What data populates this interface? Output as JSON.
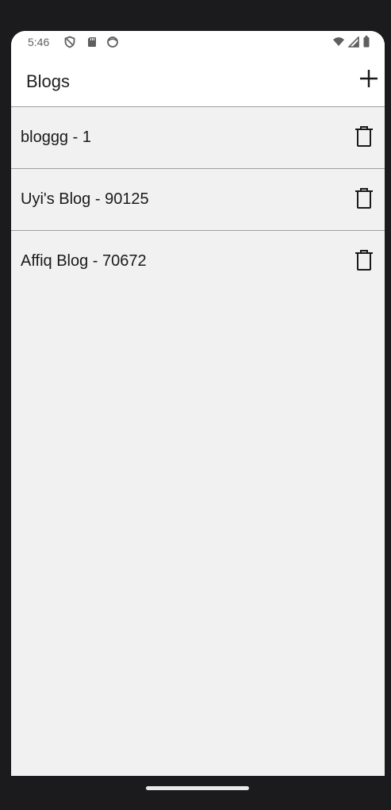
{
  "status_bar": {
    "time": "5:46",
    "left_icons": [
      "shield-icon",
      "sd-card-icon",
      "face-icon"
    ],
    "right_icons": [
      "wifi-icon",
      "signal-icon",
      "battery-icon"
    ]
  },
  "app_bar": {
    "title": "Blogs",
    "add_icon": "plus-icon"
  },
  "blogs": [
    {
      "label": "bloggg - 1",
      "action_icon": "trash-icon"
    },
    {
      "label": "Uyi's Blog - 90125",
      "action_icon": "trash-icon"
    },
    {
      "label": "Affiq Blog - 70672",
      "action_icon": "trash-icon"
    }
  ],
  "colors": {
    "background": "#f1f1f1",
    "app_bar": "#ffffff",
    "divider": "#9e9e9e",
    "text": "#1a1a1a",
    "frame": "#1b1b1d"
  }
}
